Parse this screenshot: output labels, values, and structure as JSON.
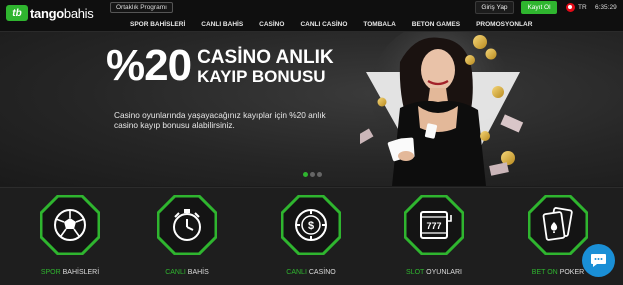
{
  "header": {
    "logo_mark": "tb",
    "logo_word_1": "tango",
    "logo_word_2": "bahis",
    "affiliate_label": "Ortaklık Programı",
    "nav": [
      "SPOR BAHİSLERİ",
      "CANLI BAHİS",
      "CASİNO",
      "CANLI CASİNO",
      "TOMBALA",
      "BETON GAMES",
      "PROMOSYONLAR"
    ],
    "login_label": "Giriş Yap",
    "signup_label": "Kayıt Ol",
    "language": "TR",
    "time": "6:35:29"
  },
  "banner": {
    "percent": "%20",
    "title_line1": "CASİNO ANLIK",
    "title_line2": "KAYIP BONUSU",
    "description": "Casino oyunlarında yaşayacağınız kayıplar için %20 anlık casino kayıp bonusu alabilirsiniz.",
    "slides": 3,
    "active_slide": 1
  },
  "categories": [
    {
      "prefix": "SPOR",
      "suffix": "BAHİSLERİ",
      "icon": "soccer-ball-icon"
    },
    {
      "prefix": "CANLI",
      "suffix": "BAHİS",
      "icon": "stopwatch-icon"
    },
    {
      "prefix": "CANLI",
      "suffix": "CASİNO",
      "icon": "casino-chip-icon"
    },
    {
      "prefix": "SLOT",
      "suffix": "OYUNLARI",
      "icon": "slot-machine-icon"
    },
    {
      "prefix": "BET ON",
      "suffix": "POKER",
      "icon": "playing-cards-icon"
    }
  ],
  "colors": {
    "accent": "#2fb52f",
    "chat": "#1a8fd6",
    "background": "#1b1b1b"
  },
  "chat_icon": "chat-bubble-icon"
}
